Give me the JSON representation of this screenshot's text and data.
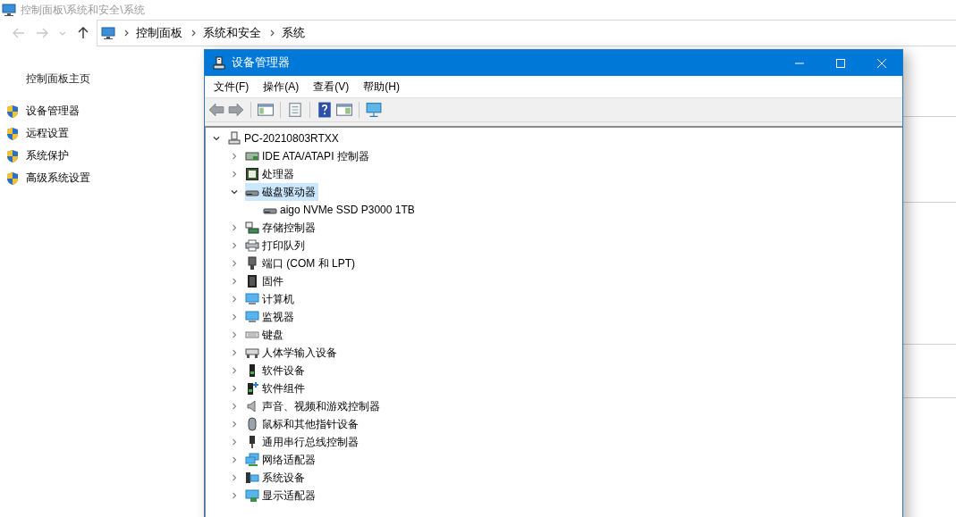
{
  "explorer": {
    "title": "控制面板\\系统和安全\\系统",
    "breadcrumb": [
      "控制面板",
      "系统和安全",
      "系统"
    ],
    "sidebar": {
      "home": "控制面板主页",
      "links": [
        "设备管理器",
        "远程设置",
        "系统保护",
        "高级系统设置"
      ]
    }
  },
  "window": {
    "title": "设备管理器",
    "menu": [
      "文件(F)",
      "操作(A)",
      "查看(V)",
      "帮助(H)"
    ],
    "tree": {
      "label": "PC-20210803RTXX",
      "kind": "tower",
      "expanded": true,
      "selected": false,
      "children": [
        {
          "label": "IDE ATA/ATAPI 控制器",
          "kind": "ide",
          "expanded": false,
          "selected": false
        },
        {
          "label": "处理器",
          "kind": "cpu",
          "expanded": false,
          "selected": false
        },
        {
          "label": "磁盘驱动器",
          "kind": "disk",
          "expanded": true,
          "selected": true,
          "children": [
            {
              "label": "aigo NVMe SSD P3000 1TB",
              "kind": "disk",
              "selected": false
            }
          ]
        },
        {
          "label": "存储控制器",
          "kind": "storage",
          "expanded": false,
          "selected": false
        },
        {
          "label": "打印队列",
          "kind": "printer",
          "expanded": false,
          "selected": false
        },
        {
          "label": "端口 (COM 和 LPT)",
          "kind": "port",
          "expanded": false,
          "selected": false
        },
        {
          "label": "固件",
          "kind": "firmware",
          "expanded": false,
          "selected": false
        },
        {
          "label": "计算机",
          "kind": "monitor",
          "expanded": false,
          "selected": false
        },
        {
          "label": "监视器",
          "kind": "monitor",
          "expanded": false,
          "selected": false
        },
        {
          "label": "键盘",
          "kind": "keyboard",
          "expanded": false,
          "selected": false
        },
        {
          "label": "人体学输入设备",
          "kind": "hid",
          "expanded": false,
          "selected": false
        },
        {
          "label": "软件设备",
          "kind": "software",
          "expanded": false,
          "selected": false
        },
        {
          "label": "软件组件",
          "kind": "component",
          "expanded": false,
          "selected": false
        },
        {
          "label": "声音、视频和游戏控制器",
          "kind": "audio",
          "expanded": false,
          "selected": false
        },
        {
          "label": "鼠标和其他指针设备",
          "kind": "mouse",
          "expanded": false,
          "selected": false
        },
        {
          "label": "通用串行总线控制器",
          "kind": "usb",
          "expanded": false,
          "selected": false
        },
        {
          "label": "网络适配器",
          "kind": "network",
          "expanded": false,
          "selected": false
        },
        {
          "label": "系统设备",
          "kind": "system",
          "expanded": false,
          "selected": false
        },
        {
          "label": "显示适配器",
          "kind": "display",
          "expanded": false,
          "selected": false
        }
      ]
    }
  }
}
